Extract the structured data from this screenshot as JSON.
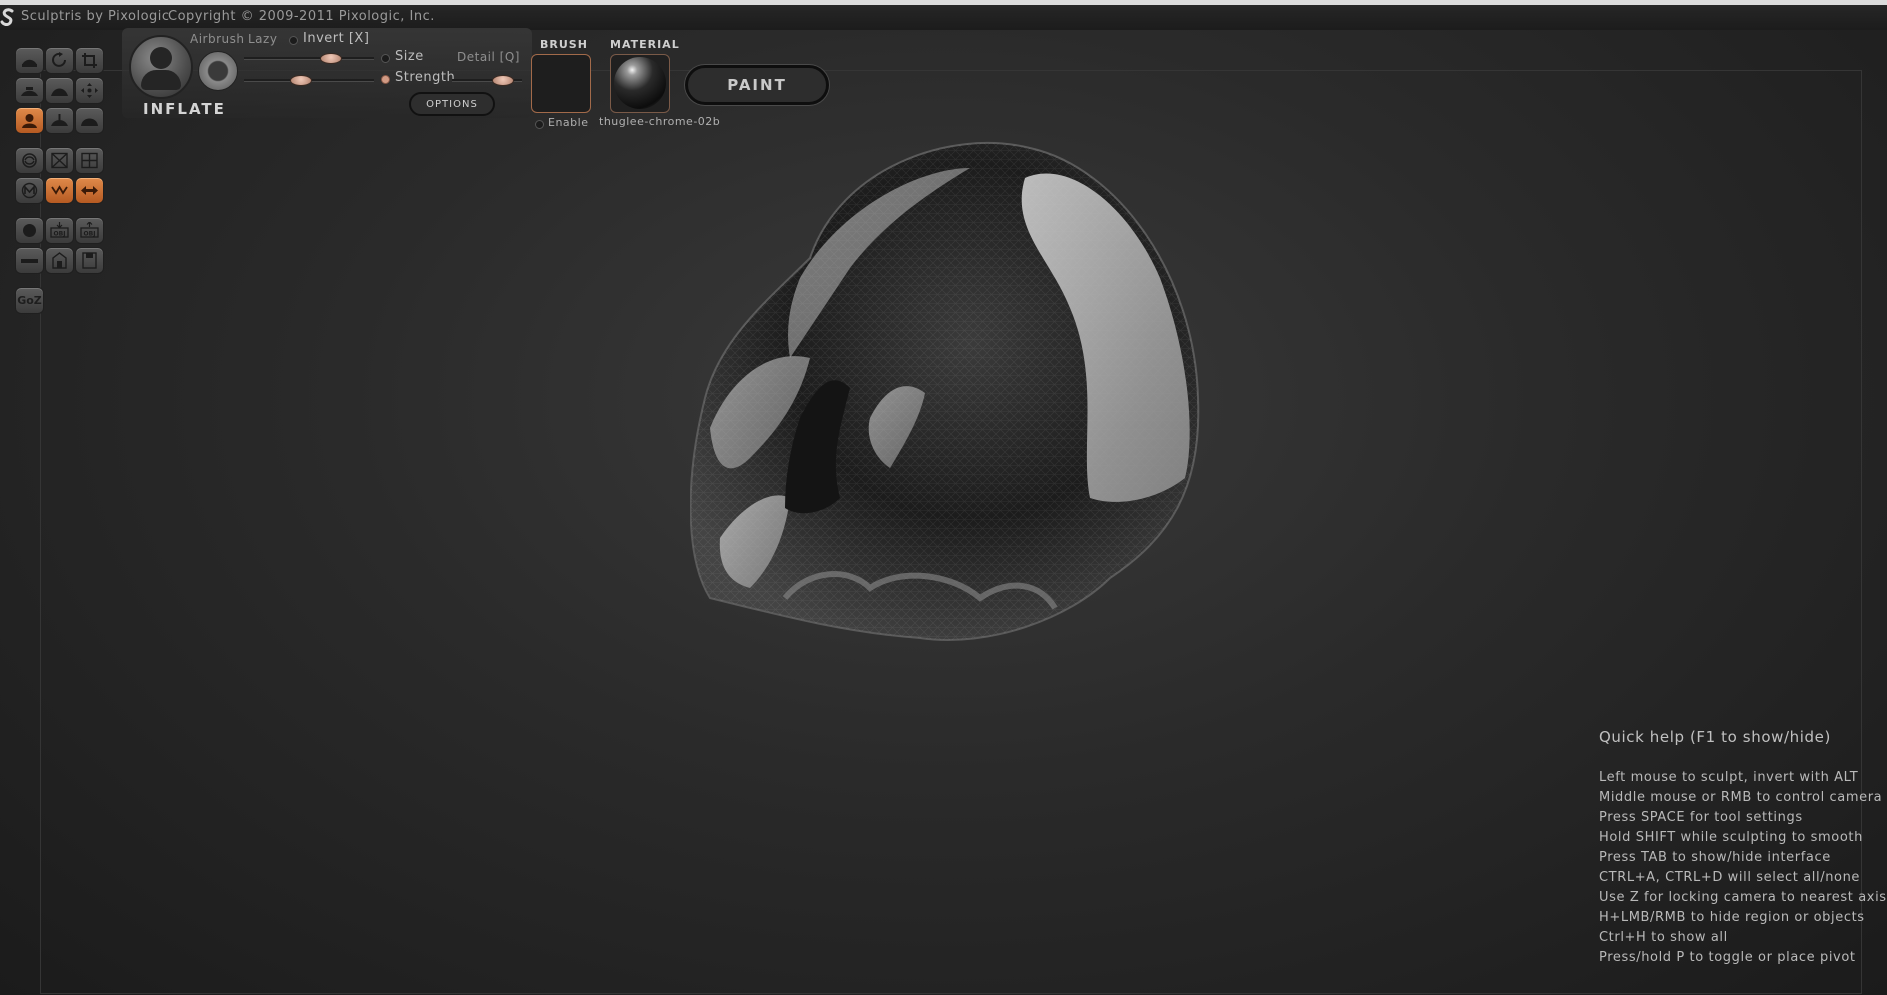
{
  "title_bar": {
    "app_name": "Sculptris by Pixologic",
    "copyright": "Copyright © 2009-2011 Pixologic, Inc."
  },
  "tool": {
    "name": "INFLATE",
    "airbrush_label": "Airbrush",
    "lazy_label": "Lazy",
    "invert_label": "Invert [X]",
    "size_label": "Size",
    "detail_label": "Detail [Q]",
    "strength_label": "Strength",
    "options_label": "OPTIONS"
  },
  "brush": {
    "title": "BRUSH",
    "enable_label": "Enable"
  },
  "material": {
    "title": "MATERIAL",
    "name": "thuglee-chrome-02b"
  },
  "paint_button": "PAINT",
  "toolbar": {
    "goz_label": "GoZ",
    "icons": [
      "draw-tool-icon",
      "rotate-tool-icon",
      "crop-tool-icon",
      "flatten-tool-icon",
      "crease-tool-icon",
      "grab-move-icon",
      "inflate-tool-icon",
      "pinch-tool-icon",
      "smooth-tool-icon",
      "reduce-brush-icon",
      "mask-icon",
      "symmetry-grid-icon",
      "wireframe-toggle-icon",
      "zigzag-symmetry-icon",
      "mirror-arrows-icon",
      "new-sphere-icon",
      "import-obj-icon",
      "export-obj-icon",
      "new-plane-icon",
      "open-file-icon",
      "save-file-icon"
    ],
    "accent_color": "#d07a3c"
  },
  "quick_help": {
    "title": "Quick help (F1 to show/hide)",
    "lines": [
      "Left mouse to sculpt, invert with ALT",
      "Middle mouse or RMB to control camera",
      "Press SPACE for tool settings",
      "Hold SHIFT while sculpting to smooth",
      "Press TAB to show/hide interface",
      "CTRL+A, CTRL+D will select all/none",
      "Use Z for locking camera to nearest axis",
      "H+LMB/RMB to hide region or objects",
      "Ctrl+H to show all",
      "Press/hold P to toggle or place pivot"
    ]
  }
}
